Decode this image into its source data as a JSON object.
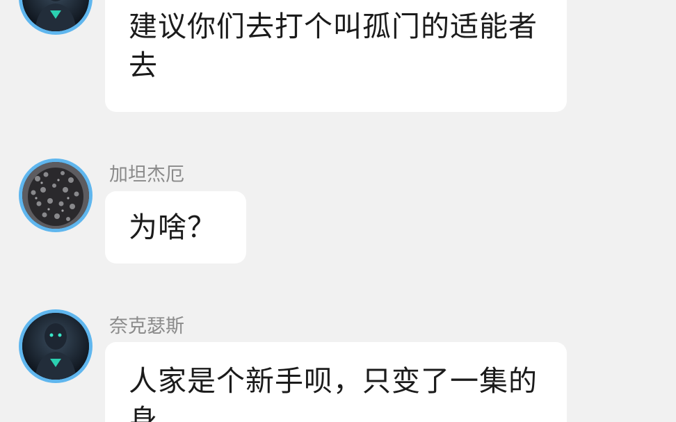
{
  "messages": [
    {
      "sender": "",
      "avatar": "dark-armored-hero-avatar",
      "text": "建议你们去打个叫孤门的适能者去"
    },
    {
      "sender": "加坦杰厄",
      "avatar": "dark-kaiju-avatar",
      "text": "为啥？"
    },
    {
      "sender": "奈克瑟斯",
      "avatar": "dark-armored-hero-avatar",
      "text": "人家是个新手呗，只变了一集的身"
    }
  ],
  "colors": {
    "background": "#f1f1f1",
    "bubble": "#ffffff",
    "avatar_ring": "#5fb6ee",
    "sender_text": "#8a8a8a",
    "message_text": "#1b1b1b"
  }
}
